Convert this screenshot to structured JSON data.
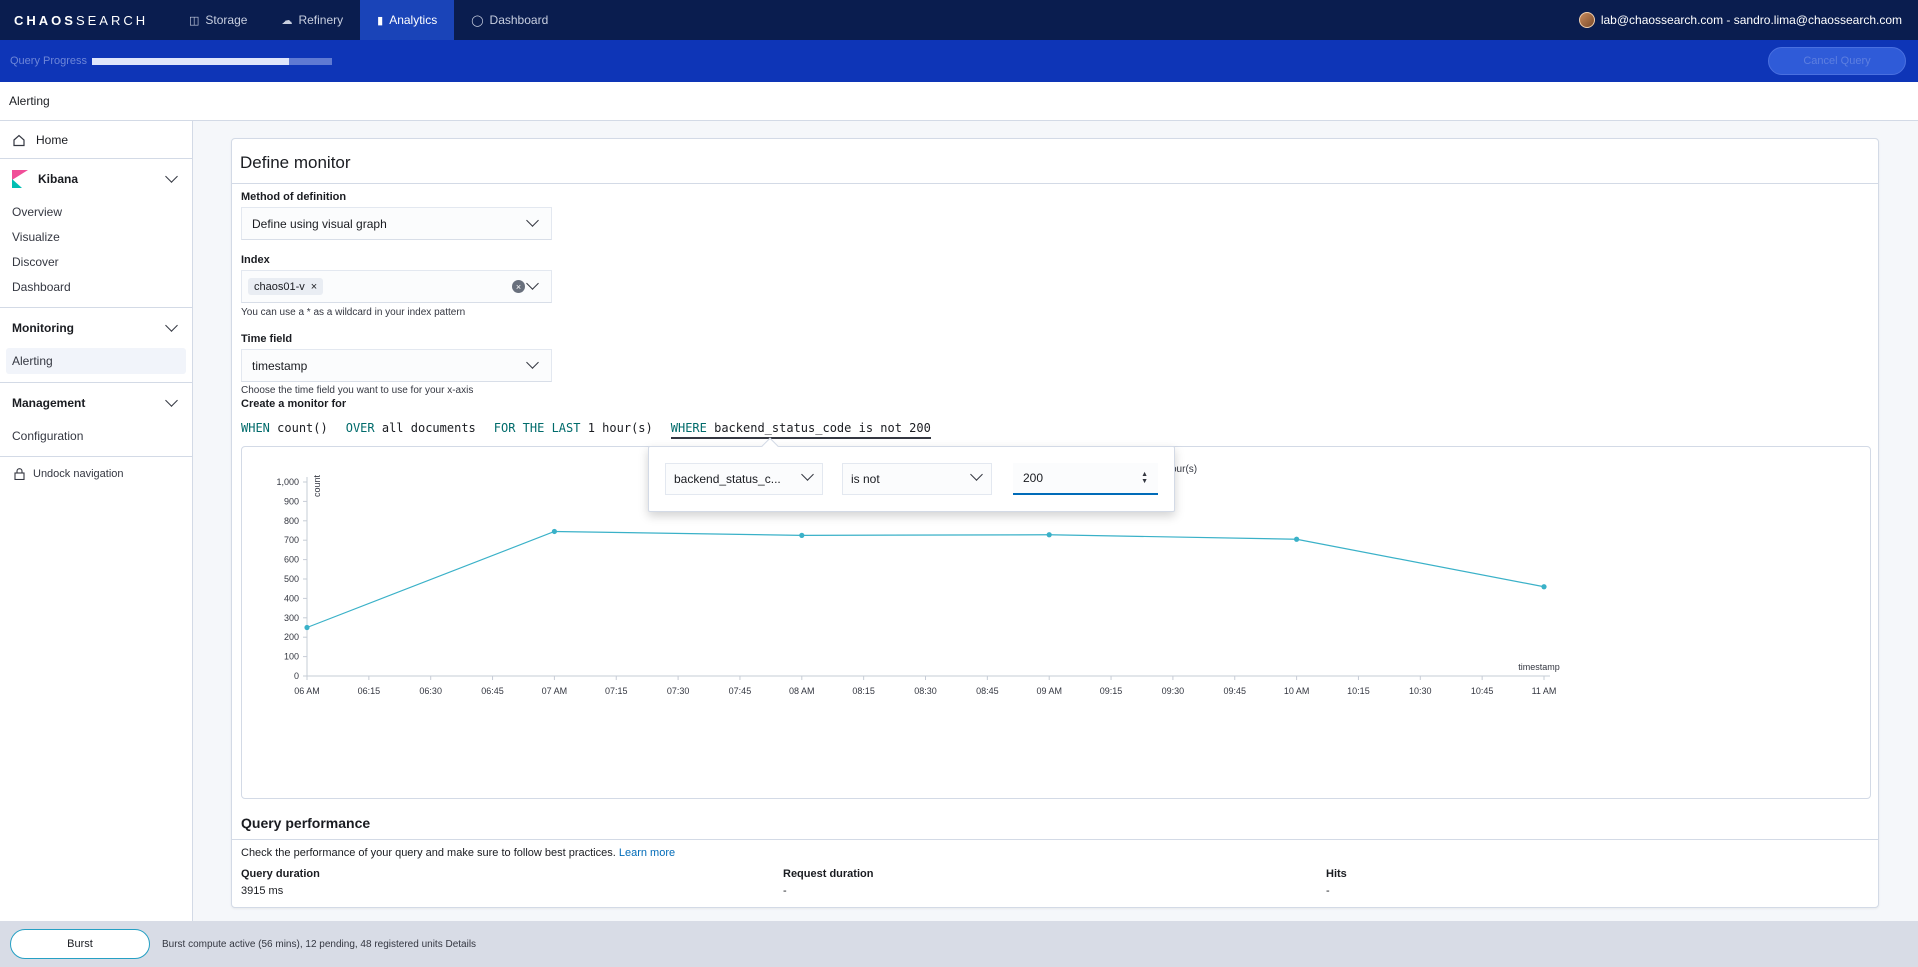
{
  "topnav": {
    "logo_bold": "CHAOS",
    "logo_light": "SEARCH",
    "tabs": [
      {
        "label": "Storage",
        "icon": "storage-icon"
      },
      {
        "label": "Refinery",
        "icon": "cloud-icon"
      },
      {
        "label": "Analytics",
        "icon": "bar-chart-icon",
        "active": true
      },
      {
        "label": "Dashboard",
        "icon": "dashboard-icon"
      }
    ],
    "user": "lab@chaossearch.com - sandro.lima@chaossearch.com"
  },
  "progress": {
    "label": "Query Progress",
    "fraction": 0.82,
    "cancel_label": "Cancel Query"
  },
  "breadcrumb": "Alerting",
  "sidenav": {
    "home": "Home",
    "kibana": {
      "title": "Kibana",
      "items": [
        "Overview",
        "Visualize",
        "Discover",
        "Dashboard"
      ]
    },
    "monitoring": {
      "title": "Monitoring",
      "items": [
        "Alerting"
      ]
    },
    "management": {
      "title": "Management",
      "items": [
        "Configuration"
      ]
    },
    "undock": "Undock navigation"
  },
  "monitor": {
    "title": "Define monitor",
    "method_label": "Method of definition",
    "method_value": "Define using visual graph",
    "index_label": "Index",
    "index_pill": "chaos01-v",
    "index_help": "You can use a * as a wildcard in your index pattern",
    "time_label": "Time field",
    "time_value": "timestamp",
    "time_help": "Choose the time field you want to use for your x-axis",
    "create_label": "Create a monitor for",
    "expr": {
      "when_kw": "WHEN",
      "when_val": "count()",
      "over_kw": "OVER",
      "over_val": "all documents",
      "for_kw": "FOR THE LAST",
      "for_val": "1 hour(s)",
      "where_kw": "WHERE",
      "where_val": "backend_status_code is not 200"
    }
  },
  "popover": {
    "field": "backend_status_c...",
    "operator": "is not",
    "value": "200",
    "behind_fragment": "our(s)"
  },
  "chart_data": {
    "type": "line",
    "x": [
      "06 AM",
      "07 AM",
      "08 AM",
      "09 AM",
      "10 AM",
      "11 AM"
    ],
    "values": [
      250,
      745,
      725,
      728,
      705,
      460
    ],
    "x_ticks": [
      "06 AM",
      "06:15",
      "06:30",
      "06:45",
      "07 AM",
      "07:15",
      "07:30",
      "07:45",
      "08 AM",
      "08:15",
      "08:30",
      "08:45",
      "09 AM",
      "09:15",
      "09:30",
      "09:45",
      "10 AM",
      "10:15",
      "10:30",
      "10:45",
      "11 AM"
    ],
    "y_ticks": [
      "0",
      "100",
      "200",
      "300",
      "400",
      "500",
      "600",
      "700",
      "800",
      "900",
      "1,000"
    ],
    "ylim": [
      0,
      1000
    ],
    "xlabel": "timestamp",
    "ylabel": "count",
    "color": "#3ab1c8"
  },
  "performance": {
    "title": "Query performance",
    "text": "Check the performance of your query and make sure to follow best practices.",
    "link": "Learn more",
    "stats": [
      {
        "label": "Query duration",
        "value": "3915 ms"
      },
      {
        "label": "Request duration",
        "value": "-"
      },
      {
        "label": "Hits",
        "value": "-"
      }
    ]
  },
  "bottombar": {
    "burst_label": "Burst",
    "status": "Burst compute active (56 mins), 12 pending, 48 registered units",
    "details": "Details"
  }
}
